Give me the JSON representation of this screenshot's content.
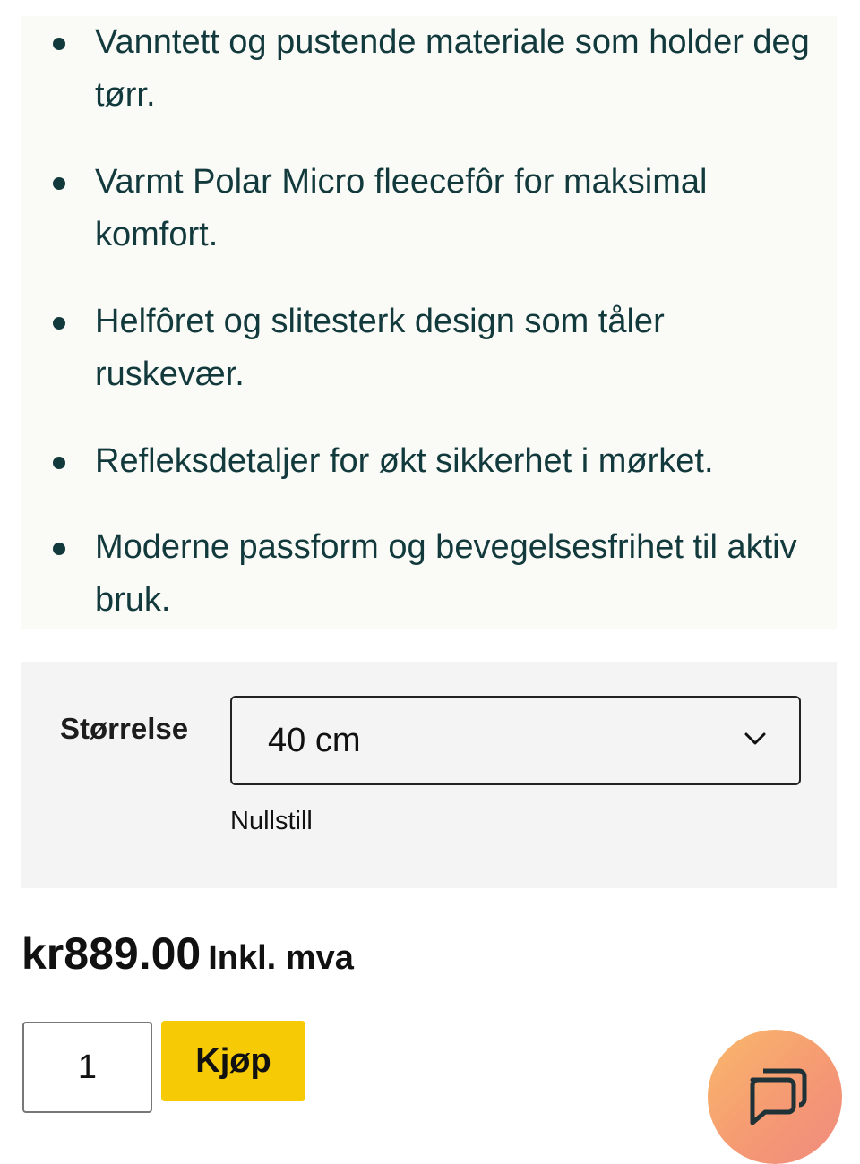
{
  "features": [
    "Vanntett og pustende materiale som holder deg tørr.",
    "Varmt Polar Micro fleecefôr for maksimal komfort.",
    "Helfôret og slitesterk design som tåler ruskevær.",
    "Refleksdetaljer for økt sikkerhet i mørket.",
    "Moderne passform og bevegelsesfrihet til aktiv bruk."
  ],
  "variant": {
    "label": "Størrelse",
    "selected": "40 cm",
    "reset": "Nullstill"
  },
  "price": {
    "amount": "kr889.00",
    "vat": "Inkl. mva"
  },
  "cart": {
    "quantity": "1",
    "buy_label": "Kjøp"
  },
  "icons": {
    "chat": "chat-icon",
    "dropdown": "chevron-down-icon"
  },
  "colors": {
    "buy_button": "#f6cb06",
    "feature_text": "#123a3c",
    "chat_gradient_start": "#f9b86a",
    "chat_gradient_end": "#f08b7e"
  }
}
